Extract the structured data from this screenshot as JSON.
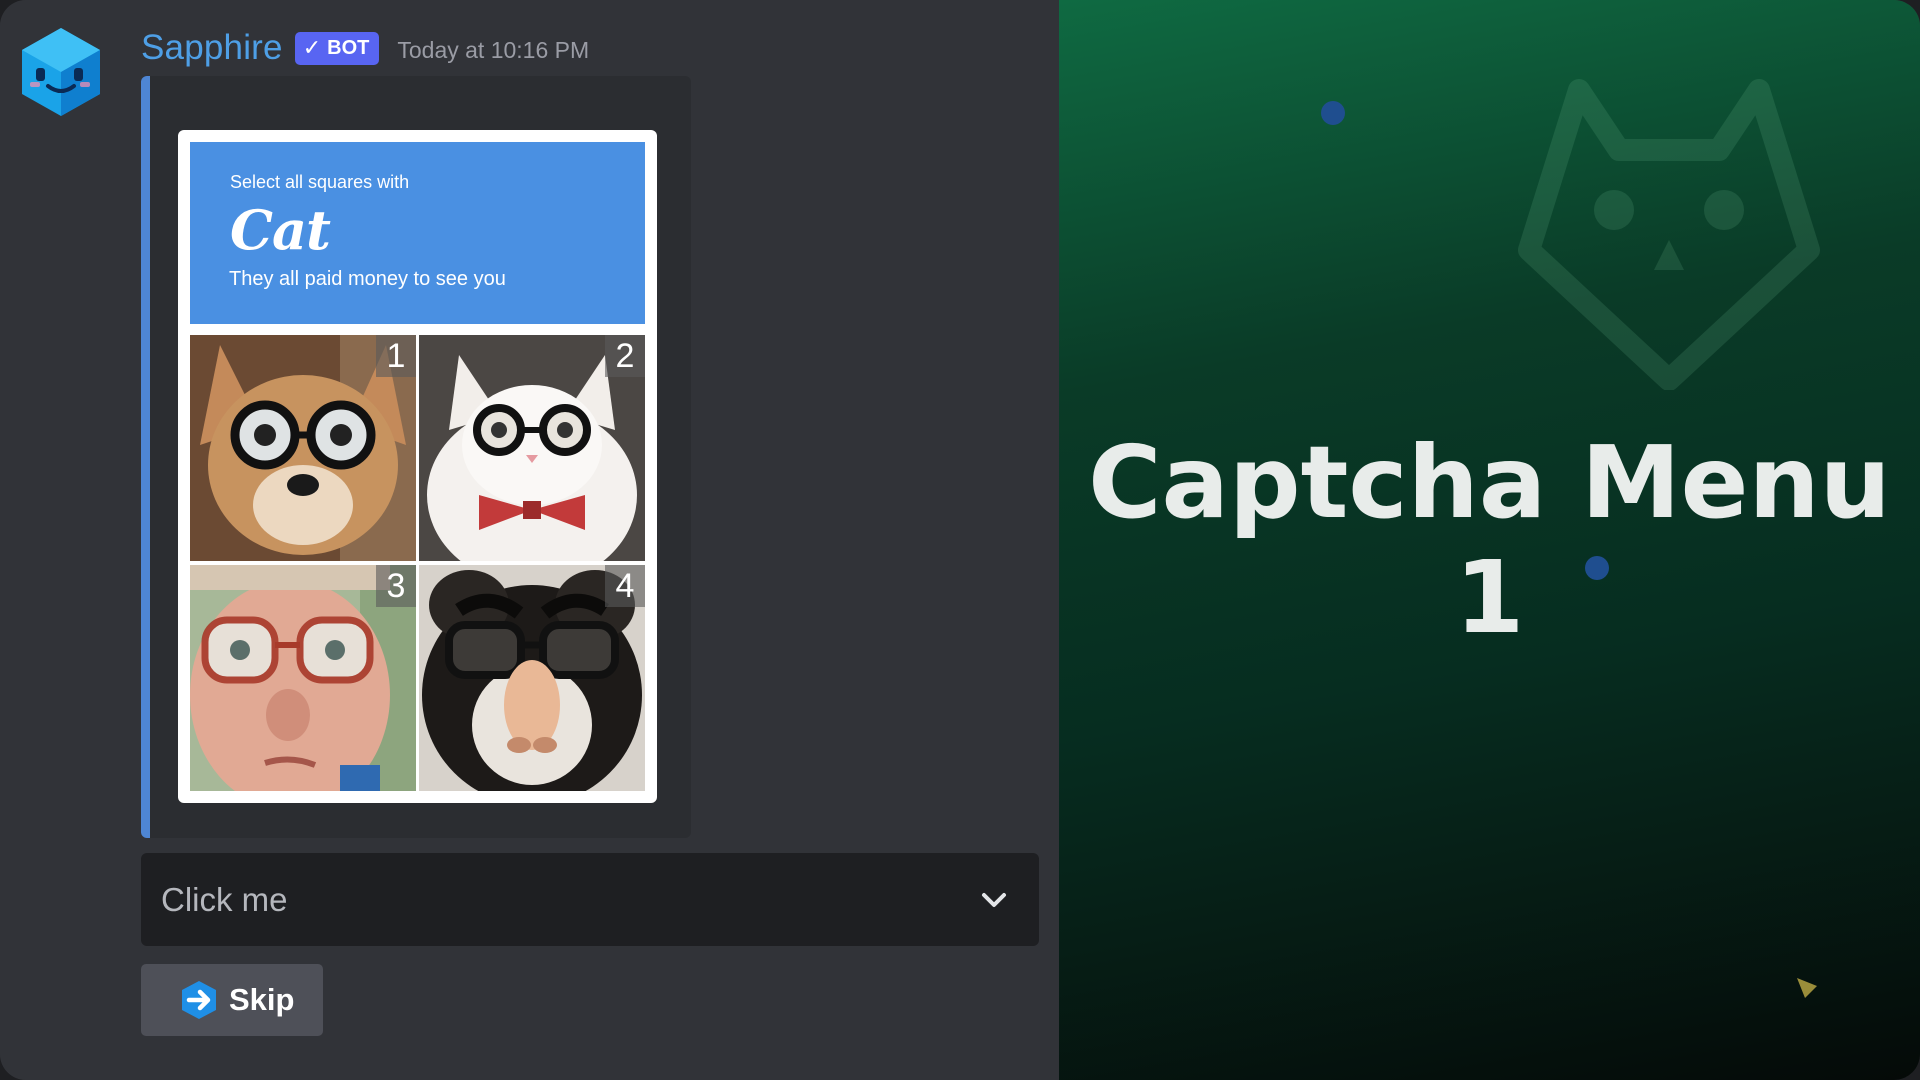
{
  "message": {
    "username": "Sapphire",
    "bot_badge": "BOT",
    "timestamp": "Today at 10:16 PM"
  },
  "captcha": {
    "instruction": "Select all squares with",
    "target_word": "Cat",
    "subtitle": "They all paid money to see you",
    "tiles": [
      {
        "number": "1",
        "content": "dog wearing glasses"
      },
      {
        "number": "2",
        "content": "white cat wearing glasses and bow tie"
      },
      {
        "number": "3",
        "content": "man wearing glasses"
      },
      {
        "number": "4",
        "content": "dog wearing novelty nose glasses"
      }
    ]
  },
  "select_menu": {
    "placeholder": "Click me"
  },
  "skip_button": {
    "label": "Skip"
  },
  "panel": {
    "title_line1": "Captcha Menu",
    "title_line2": "1"
  },
  "colors": {
    "accent_blue": "#4e86d4",
    "username": "#4e9fe6",
    "bot_badge": "#5865f2",
    "panel_green": "#0f6a42"
  },
  "icons": {
    "avatar": "sapphire-bot-avatar",
    "select_chevron": "chevron-down-icon",
    "skip": "arrow-right-icon"
  }
}
